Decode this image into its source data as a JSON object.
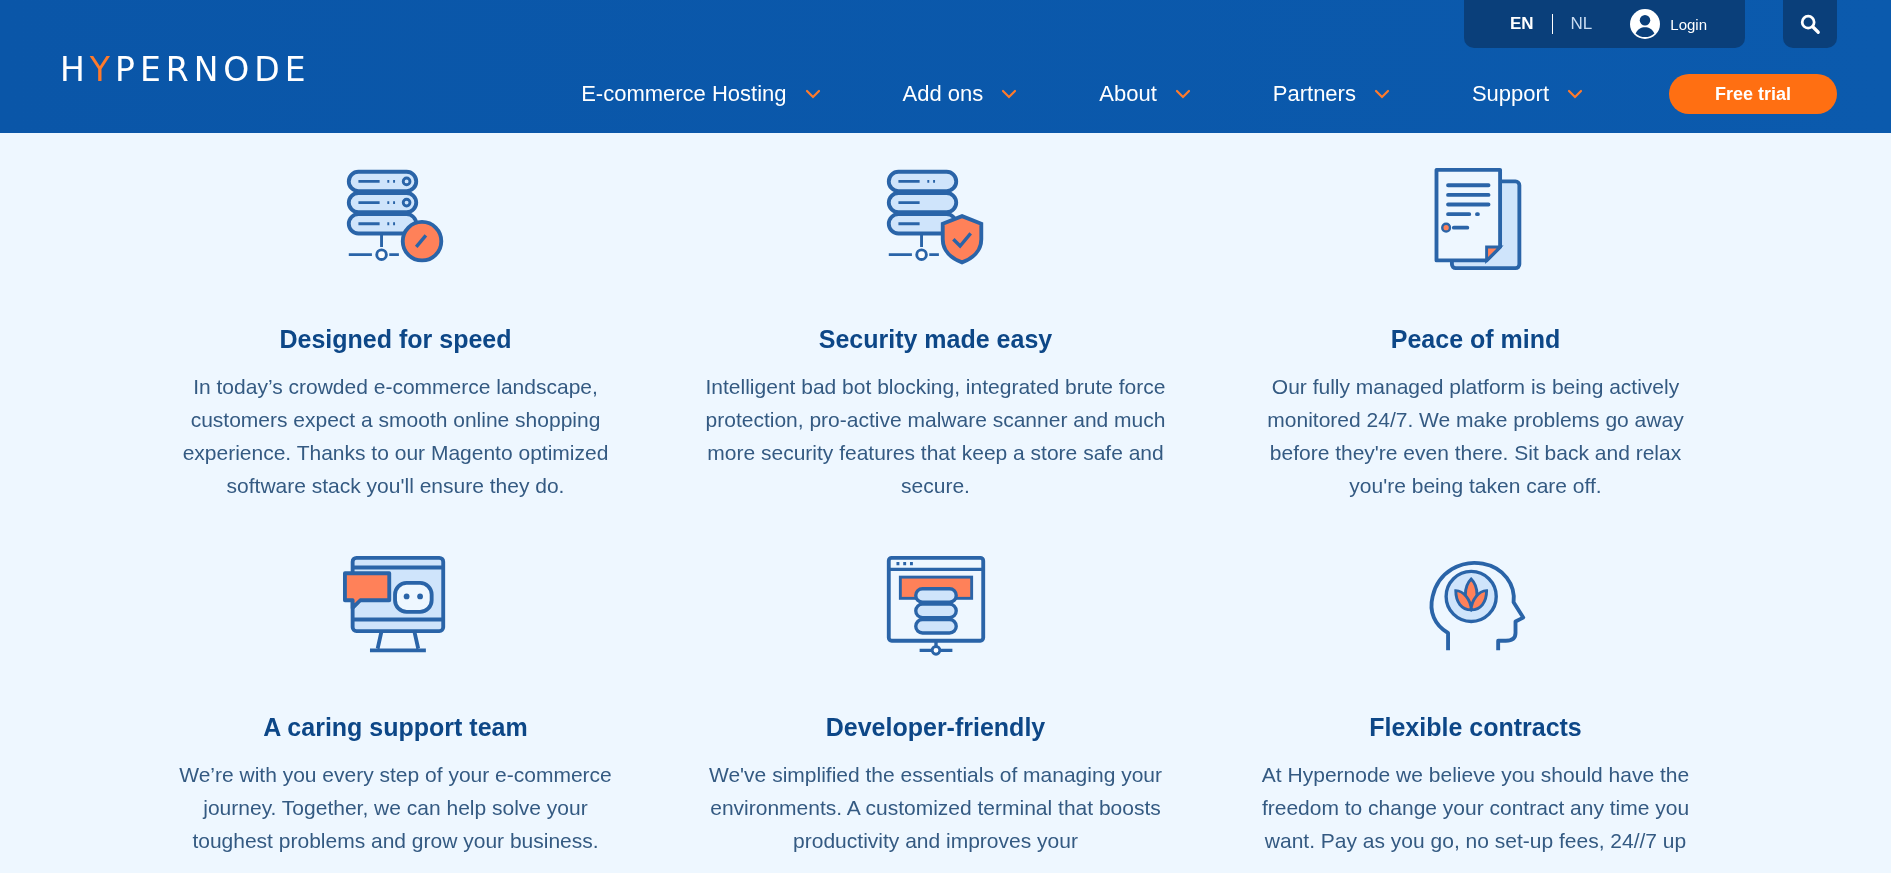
{
  "header": {
    "logo": "HYPERNODE",
    "languages": [
      {
        "label": "EN",
        "selected": true
      },
      {
        "label": "NL",
        "selected": false
      }
    ],
    "login": "Login",
    "nav": [
      {
        "label": "E-commerce Hosting"
      },
      {
        "label": "Add ons"
      },
      {
        "label": "About"
      },
      {
        "label": "Partners"
      },
      {
        "label": "Support"
      }
    ],
    "cta": "Free trial"
  },
  "features": [
    {
      "title": "Designed for speed",
      "text": "In today’s crowded e-commerce landscape, customers expect a smooth online shopping experience. Thanks to our Magento optimized software stack you'll ensure they do."
    },
    {
      "title": "Security made easy",
      "text": "Intelligent bad bot blocking, integrated brute force protection, pro-active malware scanner and much more security features that keep a store safe and secure."
    },
    {
      "title": "Peace of mind",
      "text": "Our fully managed platform is being actively monitored 24/7. We make problems go away before they're even there. Sit back and relax you're being taken care off."
    },
    {
      "title": "A caring support team",
      "text": "We’re with you every step of your e-commerce journey. Together, we can help solve your toughest problems and grow your business."
    },
    {
      "title": "Developer-friendly",
      "text": "We've simplified the essentials of managing your environments. A customized terminal that boosts productivity and improves your"
    },
    {
      "title": "Flexible contracts",
      "text": "At Hypernode we believe you should have the freedom to change your contract any time you want. Pay as you go, no set-up fees, 24//7 up"
    }
  ]
}
